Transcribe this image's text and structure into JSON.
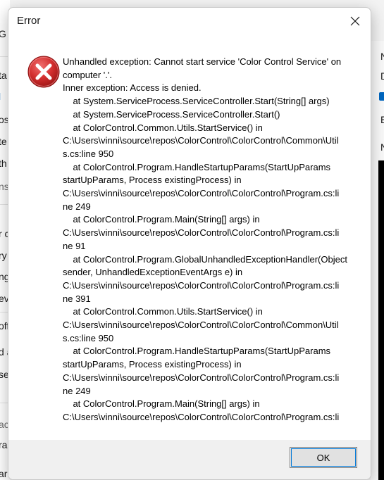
{
  "background_window": {
    "left_fragments": [
      "G",
      "ta",
      "l",
      "os",
      "te",
      "th",
      "ns",
      "r c",
      "ry",
      "ng",
      "eve",
      "off",
      "d a",
      "se",
      "ac",
      "ra",
      "ar"
    ],
    "right_fragments": [
      "N",
      "D",
      "E",
      "N"
    ]
  },
  "dialog": {
    "title": "Error",
    "close_icon": "close-icon",
    "error_icon": "error-icon",
    "error_color": "#d32f2f",
    "message_lines": [
      "Unhandled exception: Cannot start service 'Color Control Service' on",
      "computer '.'.",
      "Inner exception: Access is denied.",
      "    at System.ServiceProcess.ServiceController.Start(String[] args)",
      "    at System.ServiceProcess.ServiceController.Start()",
      "    at ColorControl.Common.Utils.StartService() in",
      "C:\\Users\\vinni\\source\\repos\\ColorControl\\ColorControl\\Common\\Util",
      "s.cs:line 950",
      "    at ColorControl.Program.HandleStartupParams(StartUpParams",
      "startUpParams, Process existingProcess) in",
      "C:\\Users\\vinni\\source\\repos\\ColorControl\\ColorControl\\Program.cs:li",
      "ne 249",
      "    at ColorControl.Program.Main(String[] args) in",
      "C:\\Users\\vinni\\source\\repos\\ColorControl\\ColorControl\\Program.cs:li",
      "ne 91",
      "    at ColorControl.Program.GlobalUnhandledExceptionHandler(Object",
      "sender, UnhandledExceptionEventArgs e) in",
      "C:\\Users\\vinni\\source\\repos\\ColorControl\\ColorControl\\Program.cs:li",
      "ne 391",
      "    at ColorControl.Common.Utils.StartService() in",
      "C:\\Users\\vinni\\source\\repos\\ColorControl\\ColorControl\\Common\\Util",
      "s.cs:line 950",
      "    at ColorControl.Program.HandleStartupParams(StartUpParams",
      "startUpParams, Process existingProcess) in",
      "C:\\Users\\vinni\\source\\repos\\ColorControl\\ColorControl\\Program.cs:li",
      "ne 249",
      "    at ColorControl.Program.Main(String[] args) in",
      "C:\\Users\\vinni\\source\\repos\\ColorControl\\ColorControl\\Program.cs:li"
    ],
    "ok_label": "OK"
  }
}
